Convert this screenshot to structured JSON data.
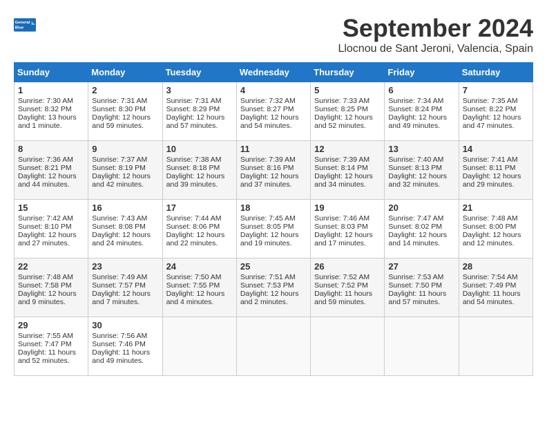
{
  "header": {
    "logo_line1": "General",
    "logo_line2": "Blue",
    "month": "September 2024",
    "location": "Llocnou de Sant Jeroni, Valencia, Spain"
  },
  "days_of_week": [
    "Sunday",
    "Monday",
    "Tuesday",
    "Wednesday",
    "Thursday",
    "Friday",
    "Saturday"
  ],
  "weeks": [
    [
      {
        "day": "1",
        "info": "Sunrise: 7:30 AM\nSunset: 8:32 PM\nDaylight: 13 hours\nand 1 minute."
      },
      {
        "day": "2",
        "info": "Sunrise: 7:31 AM\nSunset: 8:30 PM\nDaylight: 12 hours\nand 59 minutes."
      },
      {
        "day": "3",
        "info": "Sunrise: 7:31 AM\nSunset: 8:29 PM\nDaylight: 12 hours\nand 57 minutes."
      },
      {
        "day": "4",
        "info": "Sunrise: 7:32 AM\nSunset: 8:27 PM\nDaylight: 12 hours\nand 54 minutes."
      },
      {
        "day": "5",
        "info": "Sunrise: 7:33 AM\nSunset: 8:25 PM\nDaylight: 12 hours\nand 52 minutes."
      },
      {
        "day": "6",
        "info": "Sunrise: 7:34 AM\nSunset: 8:24 PM\nDaylight: 12 hours\nand 49 minutes."
      },
      {
        "day": "7",
        "info": "Sunrise: 7:35 AM\nSunset: 8:22 PM\nDaylight: 12 hours\nand 47 minutes."
      }
    ],
    [
      {
        "day": "8",
        "info": "Sunrise: 7:36 AM\nSunset: 8:21 PM\nDaylight: 12 hours\nand 44 minutes."
      },
      {
        "day": "9",
        "info": "Sunrise: 7:37 AM\nSunset: 8:19 PM\nDaylight: 12 hours\nand 42 minutes."
      },
      {
        "day": "10",
        "info": "Sunrise: 7:38 AM\nSunset: 8:18 PM\nDaylight: 12 hours\nand 39 minutes."
      },
      {
        "day": "11",
        "info": "Sunrise: 7:39 AM\nSunset: 8:16 PM\nDaylight: 12 hours\nand 37 minutes."
      },
      {
        "day": "12",
        "info": "Sunrise: 7:39 AM\nSunset: 8:14 PM\nDaylight: 12 hours\nand 34 minutes."
      },
      {
        "day": "13",
        "info": "Sunrise: 7:40 AM\nSunset: 8:13 PM\nDaylight: 12 hours\nand 32 minutes."
      },
      {
        "day": "14",
        "info": "Sunrise: 7:41 AM\nSunset: 8:11 PM\nDaylight: 12 hours\nand 29 minutes."
      }
    ],
    [
      {
        "day": "15",
        "info": "Sunrise: 7:42 AM\nSunset: 8:10 PM\nDaylight: 12 hours\nand 27 minutes."
      },
      {
        "day": "16",
        "info": "Sunrise: 7:43 AM\nSunset: 8:08 PM\nDaylight: 12 hours\nand 24 minutes."
      },
      {
        "day": "17",
        "info": "Sunrise: 7:44 AM\nSunset: 8:06 PM\nDaylight: 12 hours\nand 22 minutes."
      },
      {
        "day": "18",
        "info": "Sunrise: 7:45 AM\nSunset: 8:05 PM\nDaylight: 12 hours\nand 19 minutes."
      },
      {
        "day": "19",
        "info": "Sunrise: 7:46 AM\nSunset: 8:03 PM\nDaylight: 12 hours\nand 17 minutes."
      },
      {
        "day": "20",
        "info": "Sunrise: 7:47 AM\nSunset: 8:02 PM\nDaylight: 12 hours\nand 14 minutes."
      },
      {
        "day": "21",
        "info": "Sunrise: 7:48 AM\nSunset: 8:00 PM\nDaylight: 12 hours\nand 12 minutes."
      }
    ],
    [
      {
        "day": "22",
        "info": "Sunrise: 7:48 AM\nSunset: 7:58 PM\nDaylight: 12 hours\nand 9 minutes."
      },
      {
        "day": "23",
        "info": "Sunrise: 7:49 AM\nSunset: 7:57 PM\nDaylight: 12 hours\nand 7 minutes."
      },
      {
        "day": "24",
        "info": "Sunrise: 7:50 AM\nSunset: 7:55 PM\nDaylight: 12 hours\nand 4 minutes."
      },
      {
        "day": "25",
        "info": "Sunrise: 7:51 AM\nSunset: 7:53 PM\nDaylight: 12 hours\nand 2 minutes."
      },
      {
        "day": "26",
        "info": "Sunrise: 7:52 AM\nSunset: 7:52 PM\nDaylight: 11 hours\nand 59 minutes."
      },
      {
        "day": "27",
        "info": "Sunrise: 7:53 AM\nSunset: 7:50 PM\nDaylight: 11 hours\nand 57 minutes."
      },
      {
        "day": "28",
        "info": "Sunrise: 7:54 AM\nSunset: 7:49 PM\nDaylight: 11 hours\nand 54 minutes."
      }
    ],
    [
      {
        "day": "29",
        "info": "Sunrise: 7:55 AM\nSunset: 7:47 PM\nDaylight: 11 hours\nand 52 minutes."
      },
      {
        "day": "30",
        "info": "Sunrise: 7:56 AM\nSunset: 7:46 PM\nDaylight: 11 hours\nand 49 minutes."
      },
      {
        "day": "",
        "info": ""
      },
      {
        "day": "",
        "info": ""
      },
      {
        "day": "",
        "info": ""
      },
      {
        "day": "",
        "info": ""
      },
      {
        "day": "",
        "info": ""
      }
    ]
  ]
}
